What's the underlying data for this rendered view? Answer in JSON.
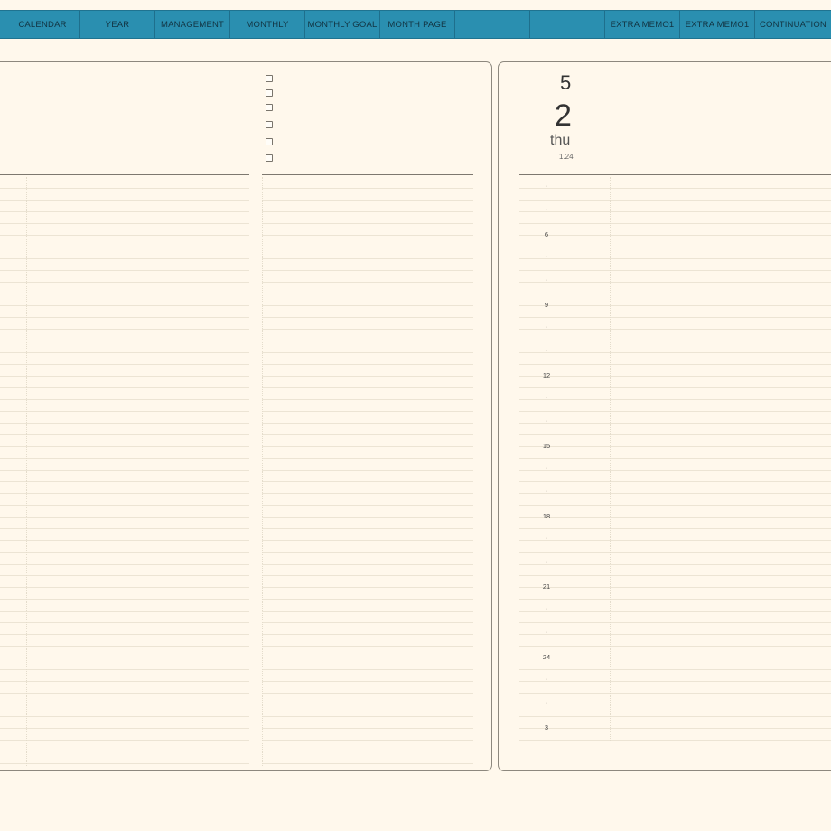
{
  "tabs": [
    {
      "label": "CALENDAR"
    },
    {
      "label": "YEAR"
    },
    {
      "label": "MANAGEMENT"
    },
    {
      "label": "MONTHLY"
    },
    {
      "label": "MONTHLY GOAL"
    },
    {
      "label": "MONTH PAGE"
    },
    {
      "label": ""
    },
    {
      "label": ""
    },
    {
      "label": "EXTRA MEMO1"
    },
    {
      "label": "EXTRA MEMO1"
    },
    {
      "label": "CONTINUATION"
    }
  ],
  "date": {
    "month": "5",
    "day": "2",
    "weekday": "thu",
    "sub": "1.24"
  },
  "hours": [
    "·",
    "·",
    "6",
    "·",
    "·",
    "9",
    "·",
    "·",
    "12",
    "·",
    "·",
    "15",
    "·",
    "·",
    "18",
    "·",
    "·",
    "21",
    "·",
    "·",
    "24",
    "·",
    "·",
    "3"
  ],
  "colors": {
    "background": "#fff8ec",
    "tab_bar": "#2a8fb0",
    "panel_border": "#8d887e",
    "rule_line": "#ece4d4"
  }
}
